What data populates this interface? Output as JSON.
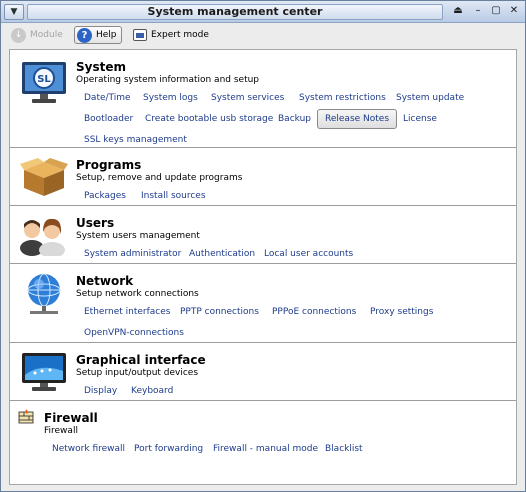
{
  "window": {
    "title": "System management center"
  },
  "toolbar": {
    "module_label": "Module",
    "help_label": "Help",
    "expert_label": "Expert mode"
  },
  "sections": [
    {
      "name": "System",
      "desc": "Operating system information and setup",
      "icon": "monitor-sl-icon",
      "links": [
        "Date/Time",
        "System logs",
        "System services",
        "System restrictions",
        "System update",
        "Bootloader",
        "Create bootable usb storage",
        "Backup",
        "Release Notes",
        "License",
        "SSL keys management"
      ]
    },
    {
      "name": "Programs",
      "desc": "Setup, remove and update programs",
      "icon": "package-box-icon",
      "links": [
        "Packages",
        "Install sources"
      ]
    },
    {
      "name": "Users",
      "desc": "System users management",
      "icon": "users-icon",
      "links": [
        "System administrator",
        "Authentication",
        "Local user accounts"
      ]
    },
    {
      "name": "Network",
      "desc": "Setup network connections",
      "icon": "globe-network-icon",
      "links": [
        "Ethernet interfaces",
        "PPTP connections",
        "PPPoE connections",
        "Proxy settings",
        "OpenVPN-connections"
      ]
    },
    {
      "name": "Graphical interface",
      "desc": "Setup input/output devices",
      "icon": "display-icon",
      "links": [
        "Display",
        "Keyboard"
      ]
    },
    {
      "name": "Firewall",
      "desc": "Firewall",
      "icon": "firewall-icon",
      "links": [
        "Network firewall",
        "Port forwarding",
        "Firewall - manual mode",
        "Blacklist"
      ]
    }
  ]
}
